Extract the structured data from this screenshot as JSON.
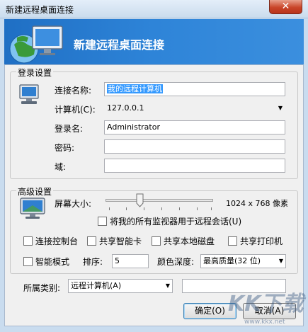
{
  "window": {
    "title": "新建远程桌面连接",
    "close_glyph": "✕"
  },
  "banner": {
    "title": "新建远程桌面连接"
  },
  "login": {
    "group_title": "登录设置",
    "name_label": "连接名称:",
    "name_value": "我的远程计算机",
    "computer_label": "计算机(C):",
    "computer_value": "127.0.0.1",
    "username_label": "登录名:",
    "username_value": "Administrator",
    "password_label": "密码:",
    "password_value": "",
    "domain_label": "域:",
    "domain_value": ""
  },
  "advanced": {
    "group_title": "高级设置",
    "screen_size_label": "屏幕大小:",
    "screen_size_value": "1024 x 768 像素",
    "slider_level_percent": 32,
    "all_monitors_label": "将我的所有监视器用于远程会话(U)",
    "console_label": "连接控制台",
    "smartcard_label": "共享智能卡",
    "local_disk_label": "共享本地磁盘",
    "printer_label": "共享打印机",
    "smart_mode_label": "智能模式",
    "sort_label": "排序:",
    "sort_value": "5",
    "color_depth_label": "颜色深度:",
    "color_depth_value": "最高质量(32 位)"
  },
  "category": {
    "label": "所属类别:",
    "value": "远程计算机(A)",
    "extra_value": ""
  },
  "buttons": {
    "ok": "确定(O)",
    "cancel": "取消(A)"
  },
  "watermark": {
    "text": "KK下载",
    "url": "www.kkx.net"
  },
  "colors": {
    "banner": "#2e84d8",
    "selection": "#3399ff",
    "close": "#c9462a"
  }
}
